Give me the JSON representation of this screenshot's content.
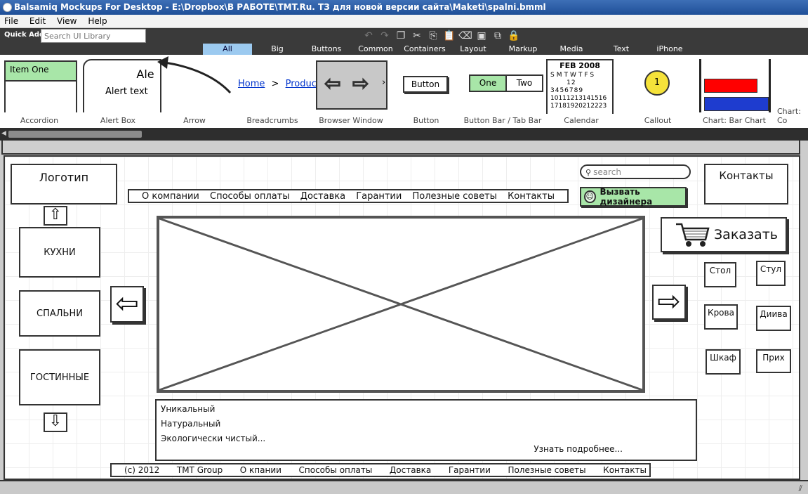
{
  "window": {
    "title": "Balsamiq Mockups For Desktop - E:\\Dropbox\\В РАБОТЕ\\TMT.Ru. ТЗ для новой версии сайта\\Maketi\\spalni.bmml"
  },
  "menu": {
    "items": [
      "File",
      "Edit",
      "View",
      "Help"
    ]
  },
  "toolbar": {
    "quick_add_label": "Quick Add:",
    "search_placeholder": "Search UI Library"
  },
  "categories": [
    "All",
    "Big",
    "Buttons",
    "Common",
    "Containers",
    "Layout",
    "Markup",
    "Media",
    "Text",
    "iPhone"
  ],
  "library": {
    "items": [
      "Accordion",
      "Alert Box",
      "Arrow",
      "Breadcrumbs",
      "Browser Window",
      "Button",
      "Button Bar / Tab Bar",
      "Calendar",
      "Callout",
      "Chart: Bar Chart",
      "Chart: Co"
    ],
    "accordion_item": "Item One",
    "alert_title": "Ale",
    "alert_text": "Alert text",
    "breadcrumb_home": "Home",
    "breadcrumb_sep": ">",
    "breadcrumb_product": "Product",
    "button_label": "Button",
    "buttonbar_one": "One",
    "buttonbar_two": "Two",
    "calendar_month": "FEB 2008",
    "calendar_days": "SMTWTFS",
    "calendar_rows": [
      "      12",
      "3456789",
      "10111213141516",
      "17181920212223"
    ],
    "callout_number": "1"
  },
  "mockup": {
    "logo": "Логотип",
    "nav": [
      "О компании",
      "Способы оплаты",
      "Доставка",
      "Гарантии",
      "Полезные советы",
      "Контакты"
    ],
    "search_placeholder": "search",
    "contacts_box": "Контакты",
    "designer_button": "Вызвать дизайнера",
    "categories": [
      "КУХНИ",
      "СПАЛЬНИ",
      "ГОСТИННЫЕ"
    ],
    "order_button": "Заказать",
    "side_items": [
      "Стол",
      "Стул",
      "Крова",
      "Диива",
      "Шкаф",
      "Прих"
    ],
    "text_lines": [
      "Уникальный",
      "Натуральный",
      "Экологически чистый..."
    ],
    "more_link": "Узнать подробнее...",
    "footer": [
      "(c) 2012",
      "TMT Group",
      "О кпании",
      "Способы оплаты",
      "Доставка",
      "Гарантии",
      "Полезные советы",
      "Контакты"
    ]
  },
  "colors": {
    "accent_tab": "#9ccaf0",
    "green": "#a8e6a8",
    "chart_red": "#f00",
    "chart_blue": "#1e3ccf"
  }
}
